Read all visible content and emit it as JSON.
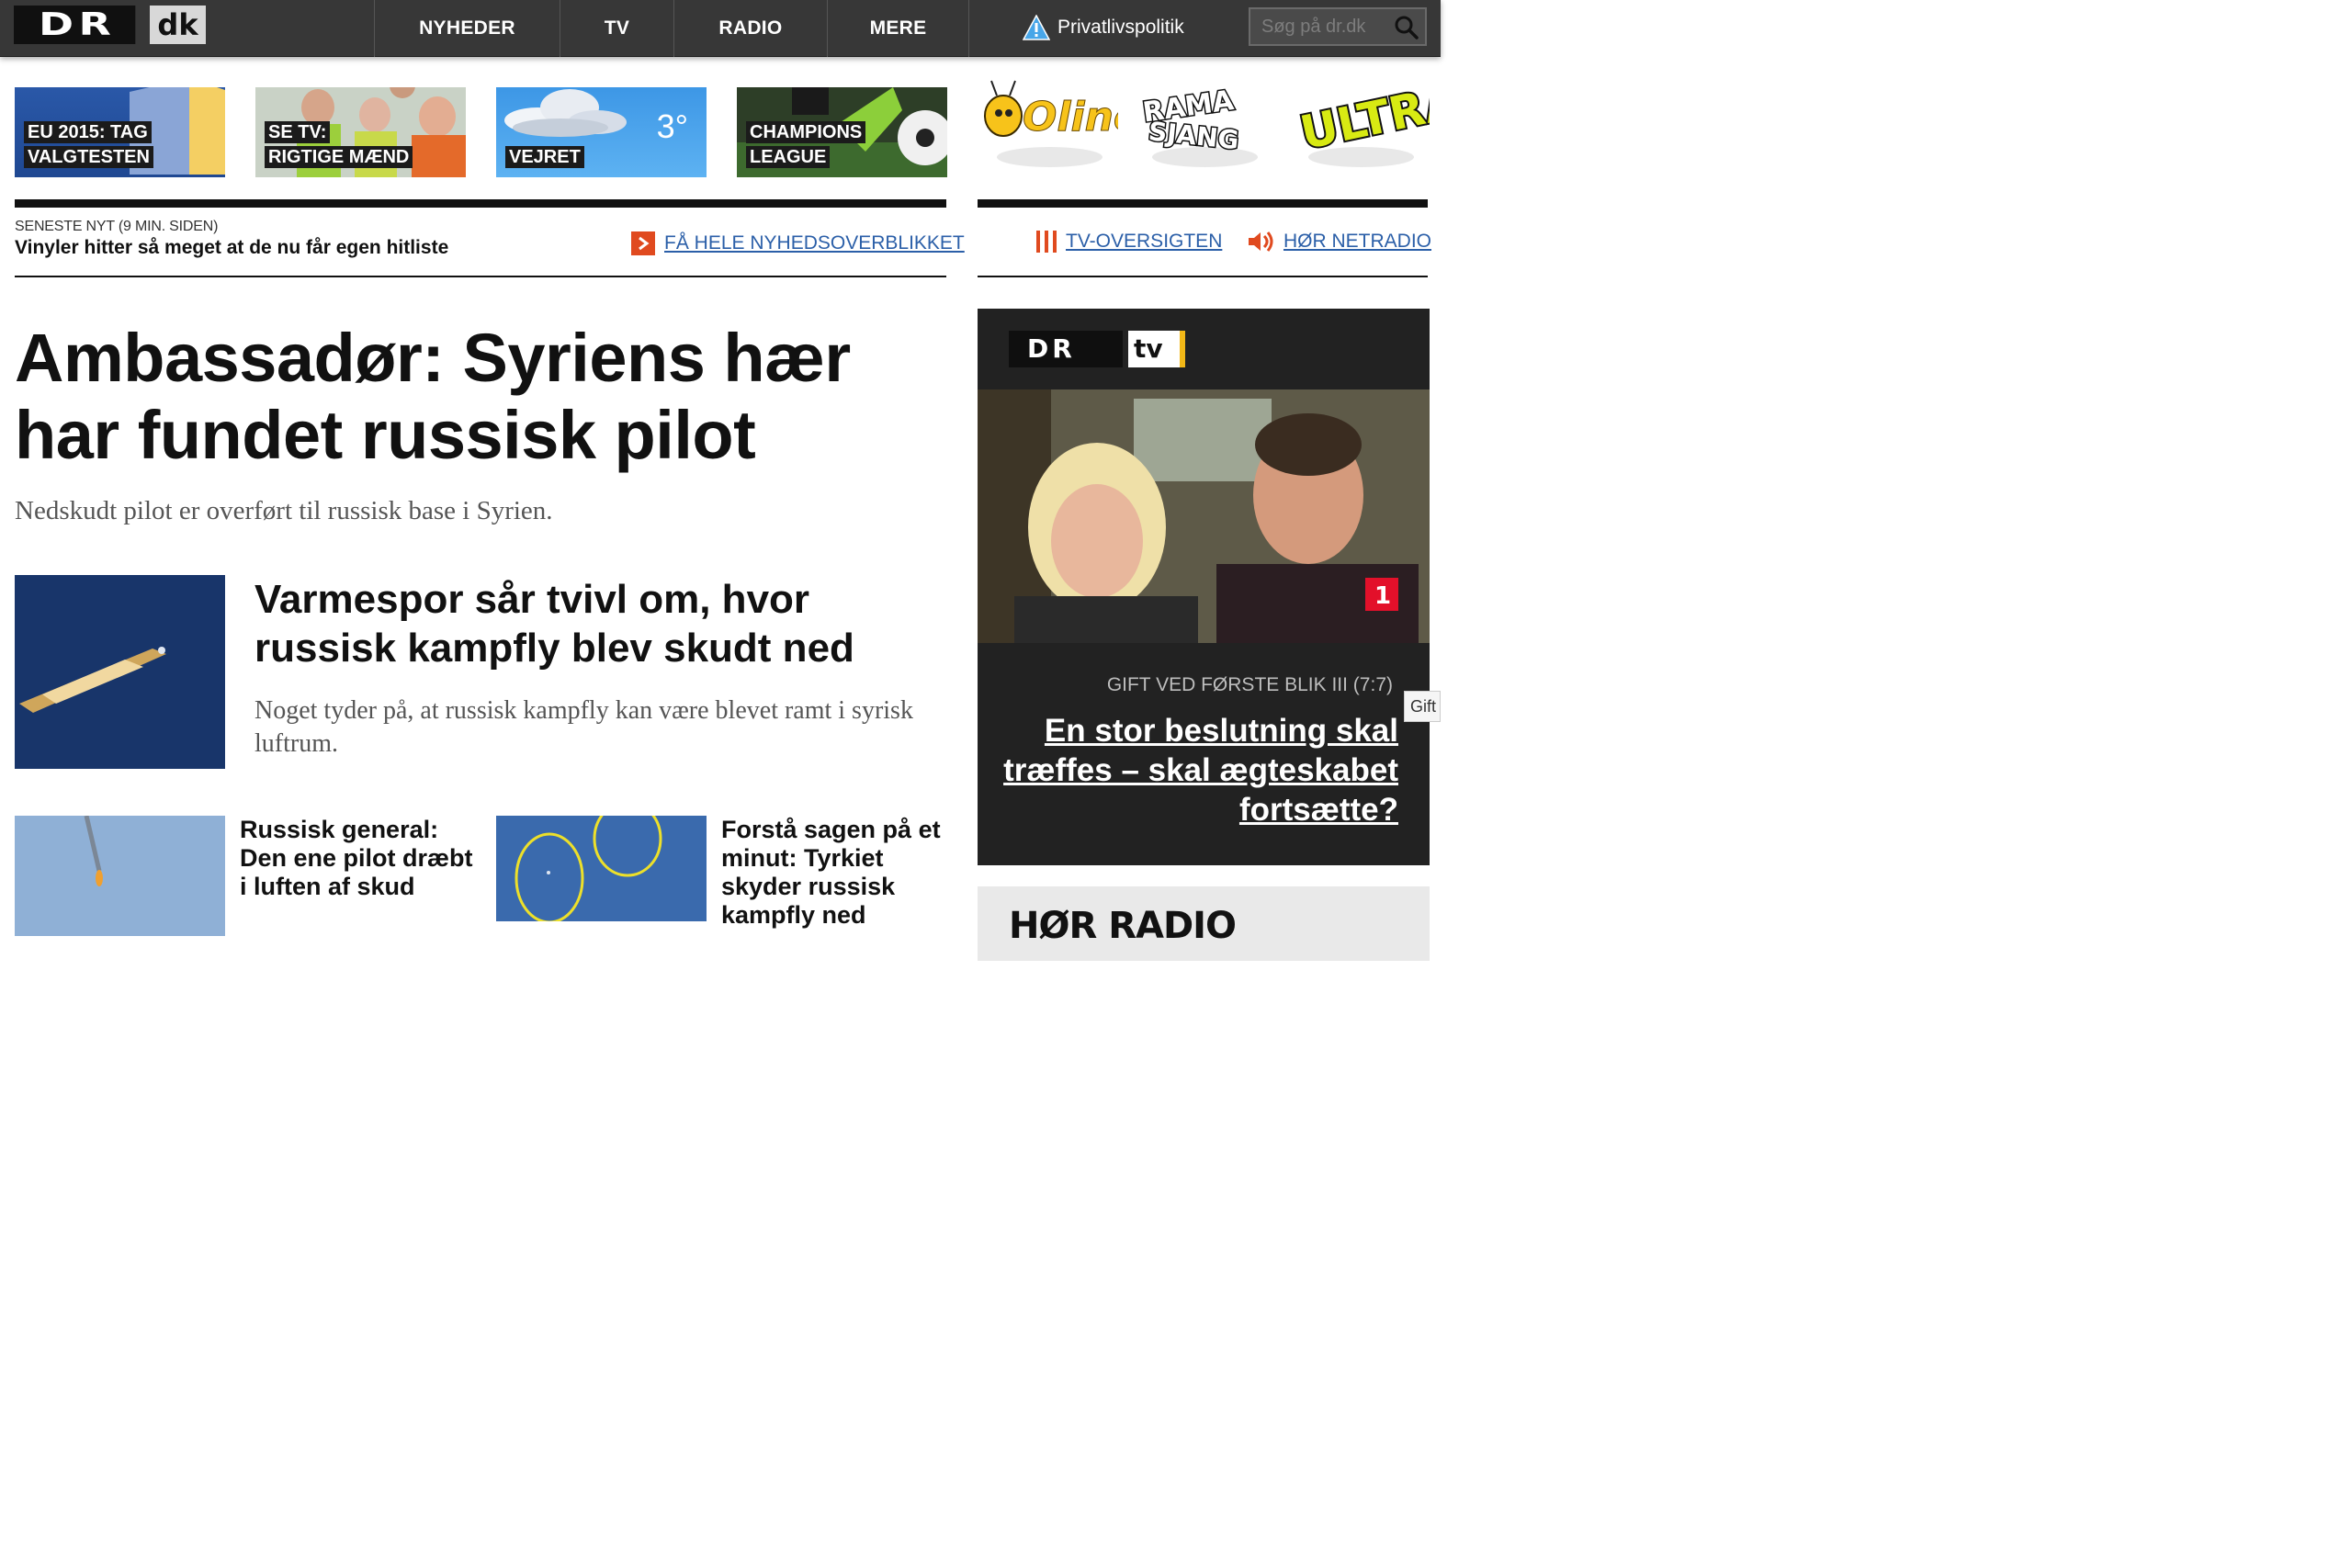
{
  "header": {
    "logo_dr": "DR",
    "logo_dk": "dk",
    "nav": [
      {
        "label": "NYHEDER"
      },
      {
        "label": "TV"
      },
      {
        "label": "RADIO"
      },
      {
        "label": "MERE"
      }
    ],
    "privacy_label": "Privatlivspolitik",
    "search_placeholder": "Søg på dr.dk"
  },
  "tiles": [
    {
      "lines": [
        "EU 2015: TAG",
        "VALGTESTEN"
      ]
    },
    {
      "lines": [
        "SE TV:",
        "RIGTIGE MÆND"
      ]
    },
    {
      "lines": [
        "VEJRET"
      ],
      "temperature": "3°"
    },
    {
      "lines": [
        "CHAMPIONS",
        "LEAGUE"
      ]
    }
  ],
  "brands": {
    "oline": "Oline",
    "ramasjang": "RAMASJANG",
    "ultra": "ULTRA"
  },
  "latest": {
    "kicker": "SENESTE NYT (9 MIN. SIDEN)",
    "title": "Vinyler hitter så meget at de nu får egen hitliste",
    "overview_link": "FÅ HELE NYHEDSOVERBLIKKET"
  },
  "side_links": {
    "tv_guide": "TV-OVERSIGTEN",
    "netradio": "HØR NETRADIO"
  },
  "main_story": {
    "headline": "Ambassadør: Syriens hær har fundet russisk pilot",
    "subhead": "Nedskudt pilot er overført til russisk base i Syrien."
  },
  "story_1": {
    "title": "Varmespor sår tvivl om, hvor russisk kampfly blev skudt ned",
    "text": "Noget tyder på, at russisk kampfly kan være blevet ramt i syrisk luftrum."
  },
  "story_2": {
    "title": "Russisk general: Den ene pilot dræbt i luften af skud"
  },
  "story_3": {
    "title": "Forstå sagen på et minut: Tyrkiet skyder russisk kampfly ned"
  },
  "drtv": {
    "logo_dr": "DR",
    "logo_tv": "tv",
    "channel_badge": "1",
    "kicker": "GIFT VED FØRSTE BLIK III (7:7)",
    "title": "En stor beslutning skal træffes – skal ægteskabet fortsætte?",
    "side_tab": "Gift"
  },
  "radio": {
    "title": "HØR RADIO"
  },
  "colors": {
    "topbar": "#373737",
    "link_blue": "#2b5fa8",
    "accent_orange": "#e04a1f",
    "tv_yellow": "#f2b817"
  }
}
